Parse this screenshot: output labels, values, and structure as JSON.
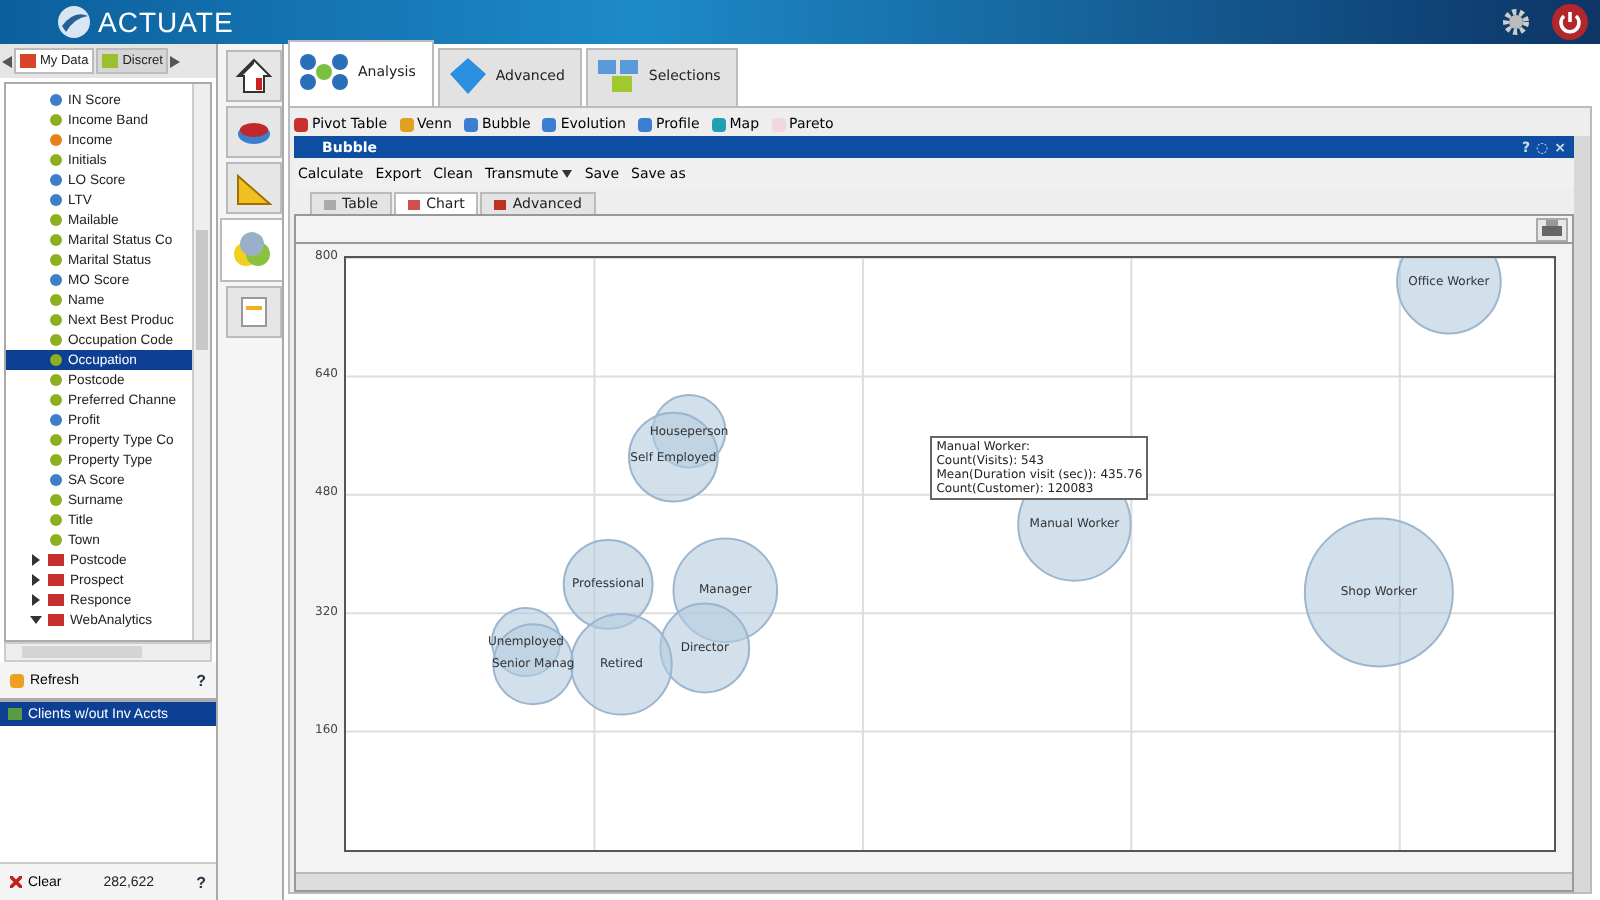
{
  "header": {
    "logo": "ACTUATE"
  },
  "left_tabs": [
    {
      "label": "My Data",
      "selected": true
    },
    {
      "label": "Discret",
      "selected": false
    }
  ],
  "tree": [
    {
      "kind": "field",
      "label": "IN Score",
      "color": "#3a7fc8",
      "selected": false
    },
    {
      "kind": "field",
      "label": "Income Band",
      "color": "#8cb020",
      "selected": false
    },
    {
      "kind": "field",
      "label": "Income",
      "color": "#e8801a",
      "selected": false
    },
    {
      "kind": "field",
      "label": "Initials",
      "color": "#8cb020",
      "selected": false
    },
    {
      "kind": "field",
      "label": "LO Score",
      "color": "#3a7fc8",
      "selected": false
    },
    {
      "kind": "field",
      "label": "LTV",
      "color": "#3a7fc8",
      "selected": false
    },
    {
      "kind": "field",
      "label": "Mailable",
      "color": "#8cb020",
      "selected": false
    },
    {
      "kind": "field",
      "label": "Marital Status Co",
      "color": "#8cb020",
      "selected": false
    },
    {
      "kind": "field",
      "label": "Marital Status",
      "color": "#8cb020",
      "selected": false
    },
    {
      "kind": "field",
      "label": "MO Score",
      "color": "#3a7fc8",
      "selected": false
    },
    {
      "kind": "field",
      "label": "Name",
      "color": "#8cb020",
      "selected": false
    },
    {
      "kind": "field",
      "label": "Next Best Produc",
      "color": "#8cb020",
      "selected": false
    },
    {
      "kind": "field",
      "label": "Occupation Code",
      "color": "#8cb020",
      "selected": false
    },
    {
      "kind": "field",
      "label": "Occupation",
      "color": "#8cb020",
      "selected": true
    },
    {
      "kind": "field",
      "label": "Postcode",
      "color": "#8cb020",
      "selected": false
    },
    {
      "kind": "field",
      "label": "Preferred Channe",
      "color": "#8cb020",
      "selected": false
    },
    {
      "kind": "field",
      "label": "Profit",
      "color": "#3a7fc8",
      "selected": false
    },
    {
      "kind": "field",
      "label": "Property Type Co",
      "color": "#8cb020",
      "selected": false
    },
    {
      "kind": "field",
      "label": "Property Type",
      "color": "#8cb020",
      "selected": false
    },
    {
      "kind": "field",
      "label": "SA Score",
      "color": "#3a7fc8",
      "selected": false
    },
    {
      "kind": "field",
      "label": "Surname",
      "color": "#8cb020",
      "selected": false
    },
    {
      "kind": "field",
      "label": "Title",
      "color": "#8cb020",
      "selected": false
    },
    {
      "kind": "field",
      "label": "Town",
      "color": "#8cb020",
      "selected": false
    },
    {
      "kind": "table",
      "label": "Postcode",
      "expanded": false,
      "selected": false
    },
    {
      "kind": "table",
      "label": "Prospect",
      "expanded": false,
      "selected": false
    },
    {
      "kind": "table",
      "label": "Responce",
      "expanded": false,
      "selected": false
    },
    {
      "kind": "table",
      "label": "WebAnalytics",
      "expanded": true,
      "selected": false
    }
  ],
  "refresh": "Refresh",
  "help": "?",
  "selections": [
    {
      "label": "Clients w/out Inv Accts",
      "selected": true
    }
  ],
  "footer": {
    "clear": "Clear",
    "count": "282,622",
    "help": "?"
  },
  "main_tabs": [
    {
      "label": "Analysis",
      "selected": true
    },
    {
      "label": "Advanced",
      "selected": false
    },
    {
      "label": "Selections",
      "selected": false
    }
  ],
  "analysis_tools": [
    "Pivot Table",
    "Venn",
    "Bubble",
    "Evolution",
    "Profile",
    "Map",
    "Pareto"
  ],
  "window": {
    "title": "Bubble",
    "controls": [
      "?",
      "◌",
      "×"
    ]
  },
  "menu": [
    {
      "label": "Calculate",
      "dropdown": false
    },
    {
      "label": "Export",
      "dropdown": false
    },
    {
      "label": "Clean",
      "dropdown": false
    },
    {
      "label": "Transmute",
      "dropdown": true
    },
    {
      "label": "Save",
      "dropdown": false
    },
    {
      "label": "Save as",
      "dropdown": false
    }
  ],
  "view_tabs": [
    {
      "label": "Table",
      "selected": false
    },
    {
      "label": "Chart",
      "selected": true
    },
    {
      "label": "Advanced",
      "selected": false
    }
  ],
  "chart": {
    "y_ticks": [
      "800",
      "640",
      "480",
      "320",
      "160"
    ],
    "bubbles": [
      {
        "label": "Office Worker"
      },
      {
        "label": "Houseperson"
      },
      {
        "label": "Self Employed"
      },
      {
        "label": "Manual Worker"
      },
      {
        "label": "Professional"
      },
      {
        "label": "Manager"
      },
      {
        "label": "Shop Worker"
      },
      {
        "label": "Unemployed"
      },
      {
        "label": "Director"
      },
      {
        "label": "Senior Manag"
      },
      {
        "label": "Retired"
      }
    ],
    "tooltip": [
      "Manual Worker:",
      "Count(Visits): 543",
      "Mean(Duration visit (sec)): 435.76",
      "Count(Customer): 120083"
    ]
  }
}
